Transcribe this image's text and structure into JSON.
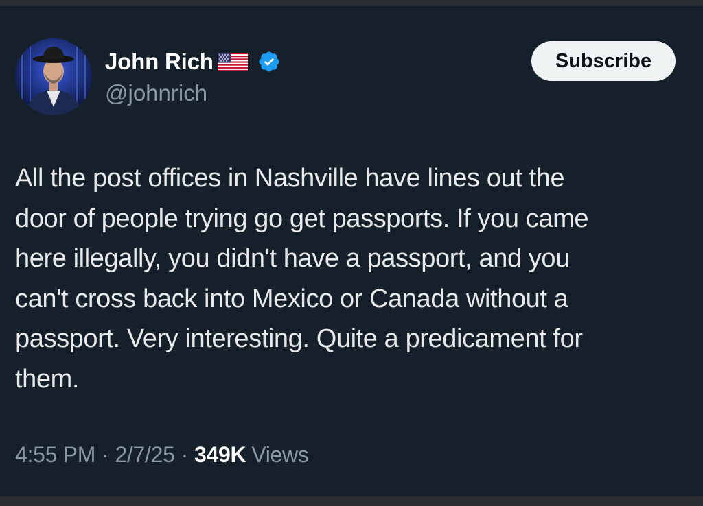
{
  "author": {
    "display_name": "John Rich",
    "handle": "@johnrich"
  },
  "header": {
    "subscribe_label": "Subscribe"
  },
  "tweet": {
    "text": "All the post offices in Nashville have lines out the\ndoor of people trying go get passports. If you came\nhere illegally, you didn't have a passport, and you\ncan't cross back into Mexico or Canada without a\npassport. Very interesting. Quite a predicament for\nthem.",
    "time": "4:55 PM",
    "separator": "·",
    "date": "2/7/25",
    "views_count": "349K",
    "views_label": "Views"
  },
  "icons": {
    "flag": "us-flag-icon",
    "verified": "verified-badge-icon"
  },
  "colors": {
    "background": "#15202b",
    "text_primary": "#e7e9ea",
    "text_secondary": "#8b98a5",
    "verified_blue": "#1d9bf0",
    "button_bg": "#eff3f4"
  }
}
